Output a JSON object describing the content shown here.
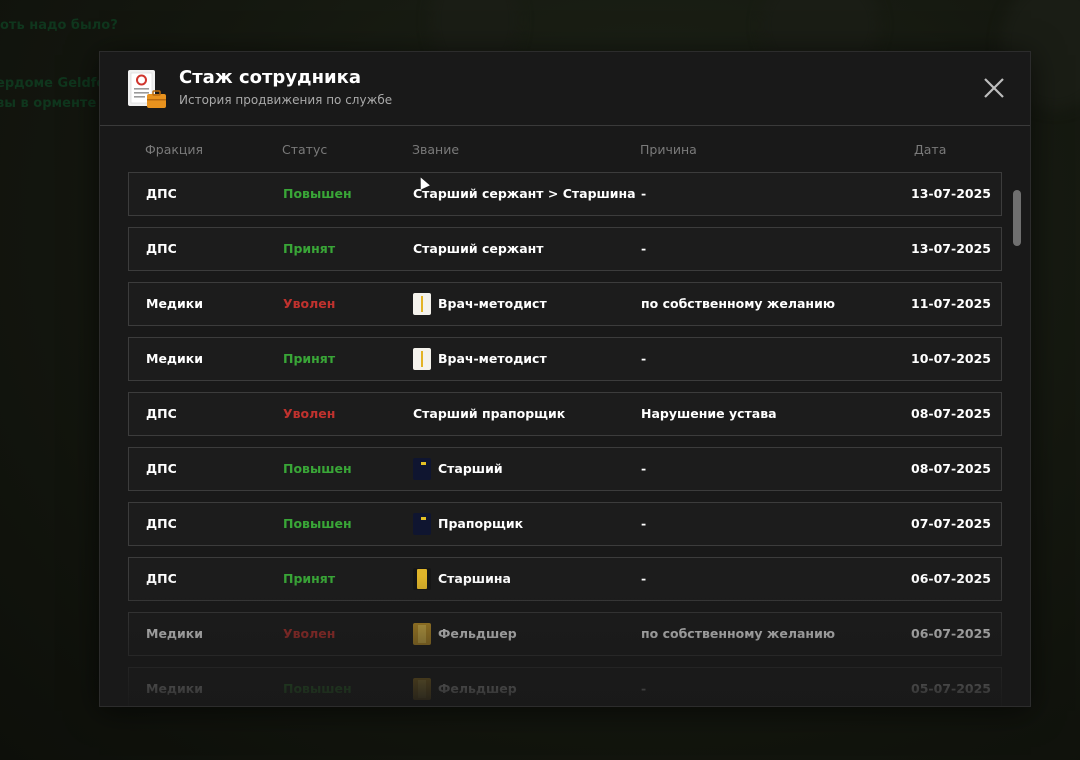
{
  "background": {
    "lines": [
      "оть надо было?",
      "ердоме Geldfel",
      "вы в орменте"
    ]
  },
  "modal": {
    "title": "Стаж сотрудника",
    "subtitle": "История продвижения по службе",
    "header_icon": "document-briefcase-icon",
    "close_icon": "close-icon"
  },
  "table": {
    "columns": [
      "Фракция",
      "Статус",
      "Звание",
      "Причина",
      "Дата"
    ],
    "rows": [
      {
        "faction": "ДПС",
        "status": "Повышен",
        "status_color": "#39a637",
        "rank": "Старший сержант > Старшина",
        "rank_icon": "",
        "reason": "-",
        "date": "13-07-2025"
      },
      {
        "faction": "ДПС",
        "status": "Принят",
        "status_color": "#39a637",
        "rank": "Старший сержант",
        "rank_icon": "",
        "reason": "-",
        "date": "13-07-2025"
      },
      {
        "faction": "Медики",
        "status": "Уволен",
        "status_color": "#c0322e",
        "rank": "Врач-методист",
        "rank_icon": "white-gold-stripe-icon",
        "reason": "по собственному желанию",
        "date": "11-07-2025"
      },
      {
        "faction": "Медики",
        "status": "Принят",
        "status_color": "#39a637",
        "rank": "Врач-методист",
        "rank_icon": "white-gold-stripe-icon",
        "reason": "-",
        "date": "10-07-2025"
      },
      {
        "faction": "ДПС",
        "status": "Уволен",
        "status_color": "#c0322e",
        "rank": "Старший прапорщик",
        "rank_icon": "",
        "reason": "Нарушение устава",
        "date": "08-07-2025"
      },
      {
        "faction": "ДПС",
        "status": "Повышен",
        "status_color": "#39a637",
        "rank": "Старший",
        "rank_icon": "navy-dotted-icon",
        "reason": "-",
        "date": "08-07-2025"
      },
      {
        "faction": "ДПС",
        "status": "Повышен",
        "status_color": "#39a637",
        "rank": "Прапорщик",
        "rank_icon": "navy-dotted-icon",
        "reason": "-",
        "date": "07-07-2025"
      },
      {
        "faction": "ДПС",
        "status": "Принят",
        "status_color": "#39a637",
        "rank": "Старшина",
        "rank_icon": "gold-bar-icon",
        "reason": "-",
        "date": "06-07-2025"
      },
      {
        "faction": "Медики",
        "status": "Уволен",
        "status_color": "#c0322e",
        "rank": "Фельдшер",
        "rank_icon": "gold-wide-icon",
        "reason": "по собственному желанию",
        "date": "06-07-2025"
      },
      {
        "faction": "Медики",
        "status": "Повышен",
        "status_color": "#39a637",
        "rank": "Фельдшер",
        "rank_icon": "gold-wide-icon",
        "reason": "-",
        "date": "05-07-2025"
      }
    ]
  }
}
